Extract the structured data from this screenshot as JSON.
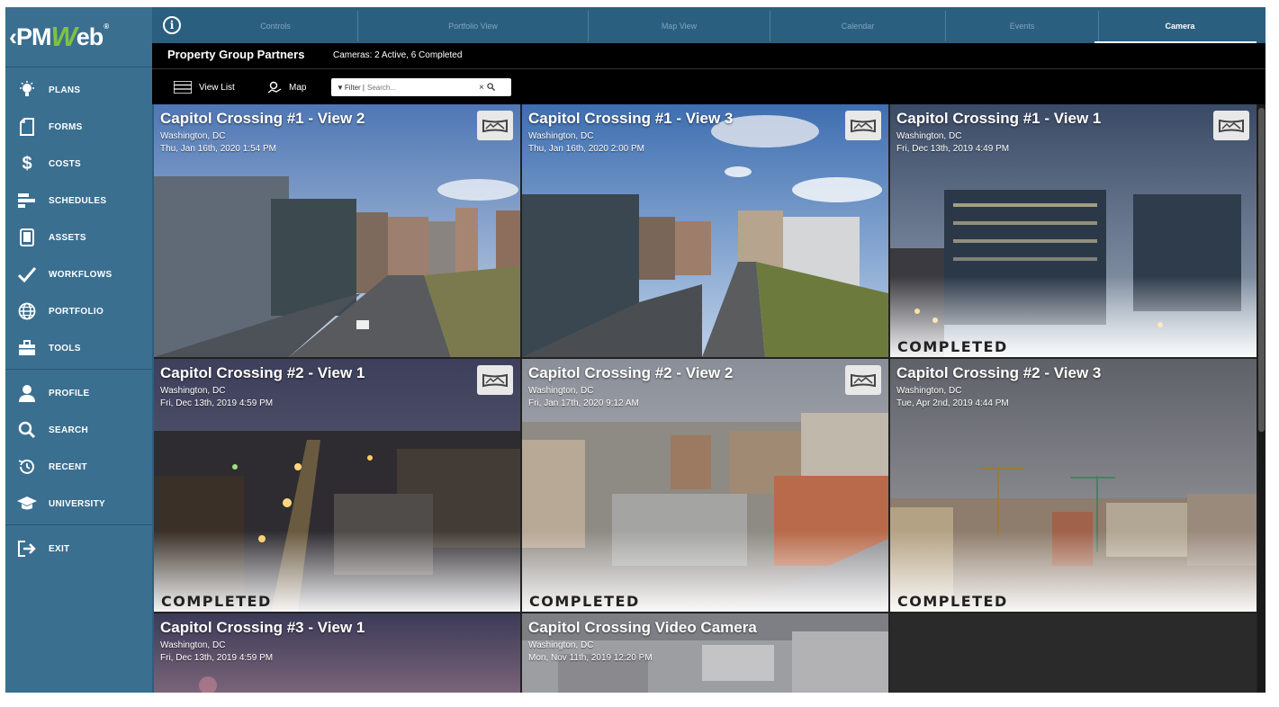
{
  "sidebar": {
    "logo": {
      "prefix": "‹PM",
      "w": "W",
      "suffix": "eb",
      "reg": "®"
    },
    "items": [
      {
        "label": "PLANS",
        "icon": "lightbulb-icon"
      },
      {
        "label": "FORMS",
        "icon": "document-icon"
      },
      {
        "label": "COSTS",
        "icon": "dollar-icon"
      },
      {
        "label": "SCHEDULES",
        "icon": "gantt-icon"
      },
      {
        "label": "ASSETS",
        "icon": "tablet-icon"
      },
      {
        "label": "WORKFLOWS",
        "icon": "checkmark-icon"
      },
      {
        "label": "PORTFOLIO",
        "icon": "globe-icon"
      },
      {
        "label": "TOOLS",
        "icon": "toolbox-icon"
      },
      {
        "label": "PROFILE",
        "icon": "person-icon"
      },
      {
        "label": "SEARCH",
        "icon": "search-icon"
      },
      {
        "label": "RECENT",
        "icon": "history-icon"
      },
      {
        "label": "UNIVERSITY",
        "icon": "graduation-cap-icon"
      },
      {
        "label": "EXIT",
        "icon": "exit-icon"
      }
    ]
  },
  "topbar": {
    "tabs": [
      "Controls",
      "Portfolio View",
      "Map View",
      "Calendar",
      "Events",
      "Camera"
    ],
    "active_tab": "Camera"
  },
  "header": {
    "org_name": "Property Group Partners",
    "camera_summary": "Cameras: 2 Active, 6 Completed",
    "view_list_label": "View List",
    "map_label": "Map",
    "filter_label": "Filter |",
    "filter_placeholder": "Search..."
  },
  "cameras": [
    {
      "title": "Capitol Crossing #1 - View 2",
      "location": "Washington, DC",
      "date": "Thu, Jan 16th, 2020 1:54 PM",
      "status": "",
      "live": true
    },
    {
      "title": "Capitol Crossing #1 - View 3",
      "location": "Washington, DC",
      "date": "Thu, Jan 16th, 2020 2:00 PM",
      "status": "",
      "live": true
    },
    {
      "title": "Capitol Crossing #1 - View 1",
      "location": "Washington, DC",
      "date": "Fri, Dec 13th, 2019 4:49 PM",
      "status": "COMPLETED",
      "live": true
    },
    {
      "title": "Capitol Crossing #2 - View 1",
      "location": "Washington, DC",
      "date": "Fri, Dec 13th, 2019 4:59 PM",
      "status": "COMPLETED",
      "live": true
    },
    {
      "title": "Capitol Crossing #2 - View 2",
      "location": "Washington, DC",
      "date": "Fri, Jan 17th, 2020 9:12 AM",
      "status": "COMPLETED",
      "live": true
    },
    {
      "title": "Capitol Crossing #2 - View 3",
      "location": "Washington, DC",
      "date": "Tue, Apr 2nd, 2019 4:44 PM",
      "status": "COMPLETED",
      "live": false
    },
    {
      "title": "Capitol Crossing #3 - View 1",
      "location": "Washington, DC",
      "date": "Fri, Dec 13th, 2019 4:59 PM",
      "status": "",
      "live": false
    },
    {
      "title": "Capitol Crossing Video Camera",
      "location": "Washington, DC",
      "date": "Mon, Nov 11th, 2019 12:20 PM",
      "status": "",
      "live": false
    }
  ],
  "colors": {
    "sidebar": "#3a6f90",
    "topbar": "#2b5f80",
    "logo_accent": "#7dc242"
  }
}
